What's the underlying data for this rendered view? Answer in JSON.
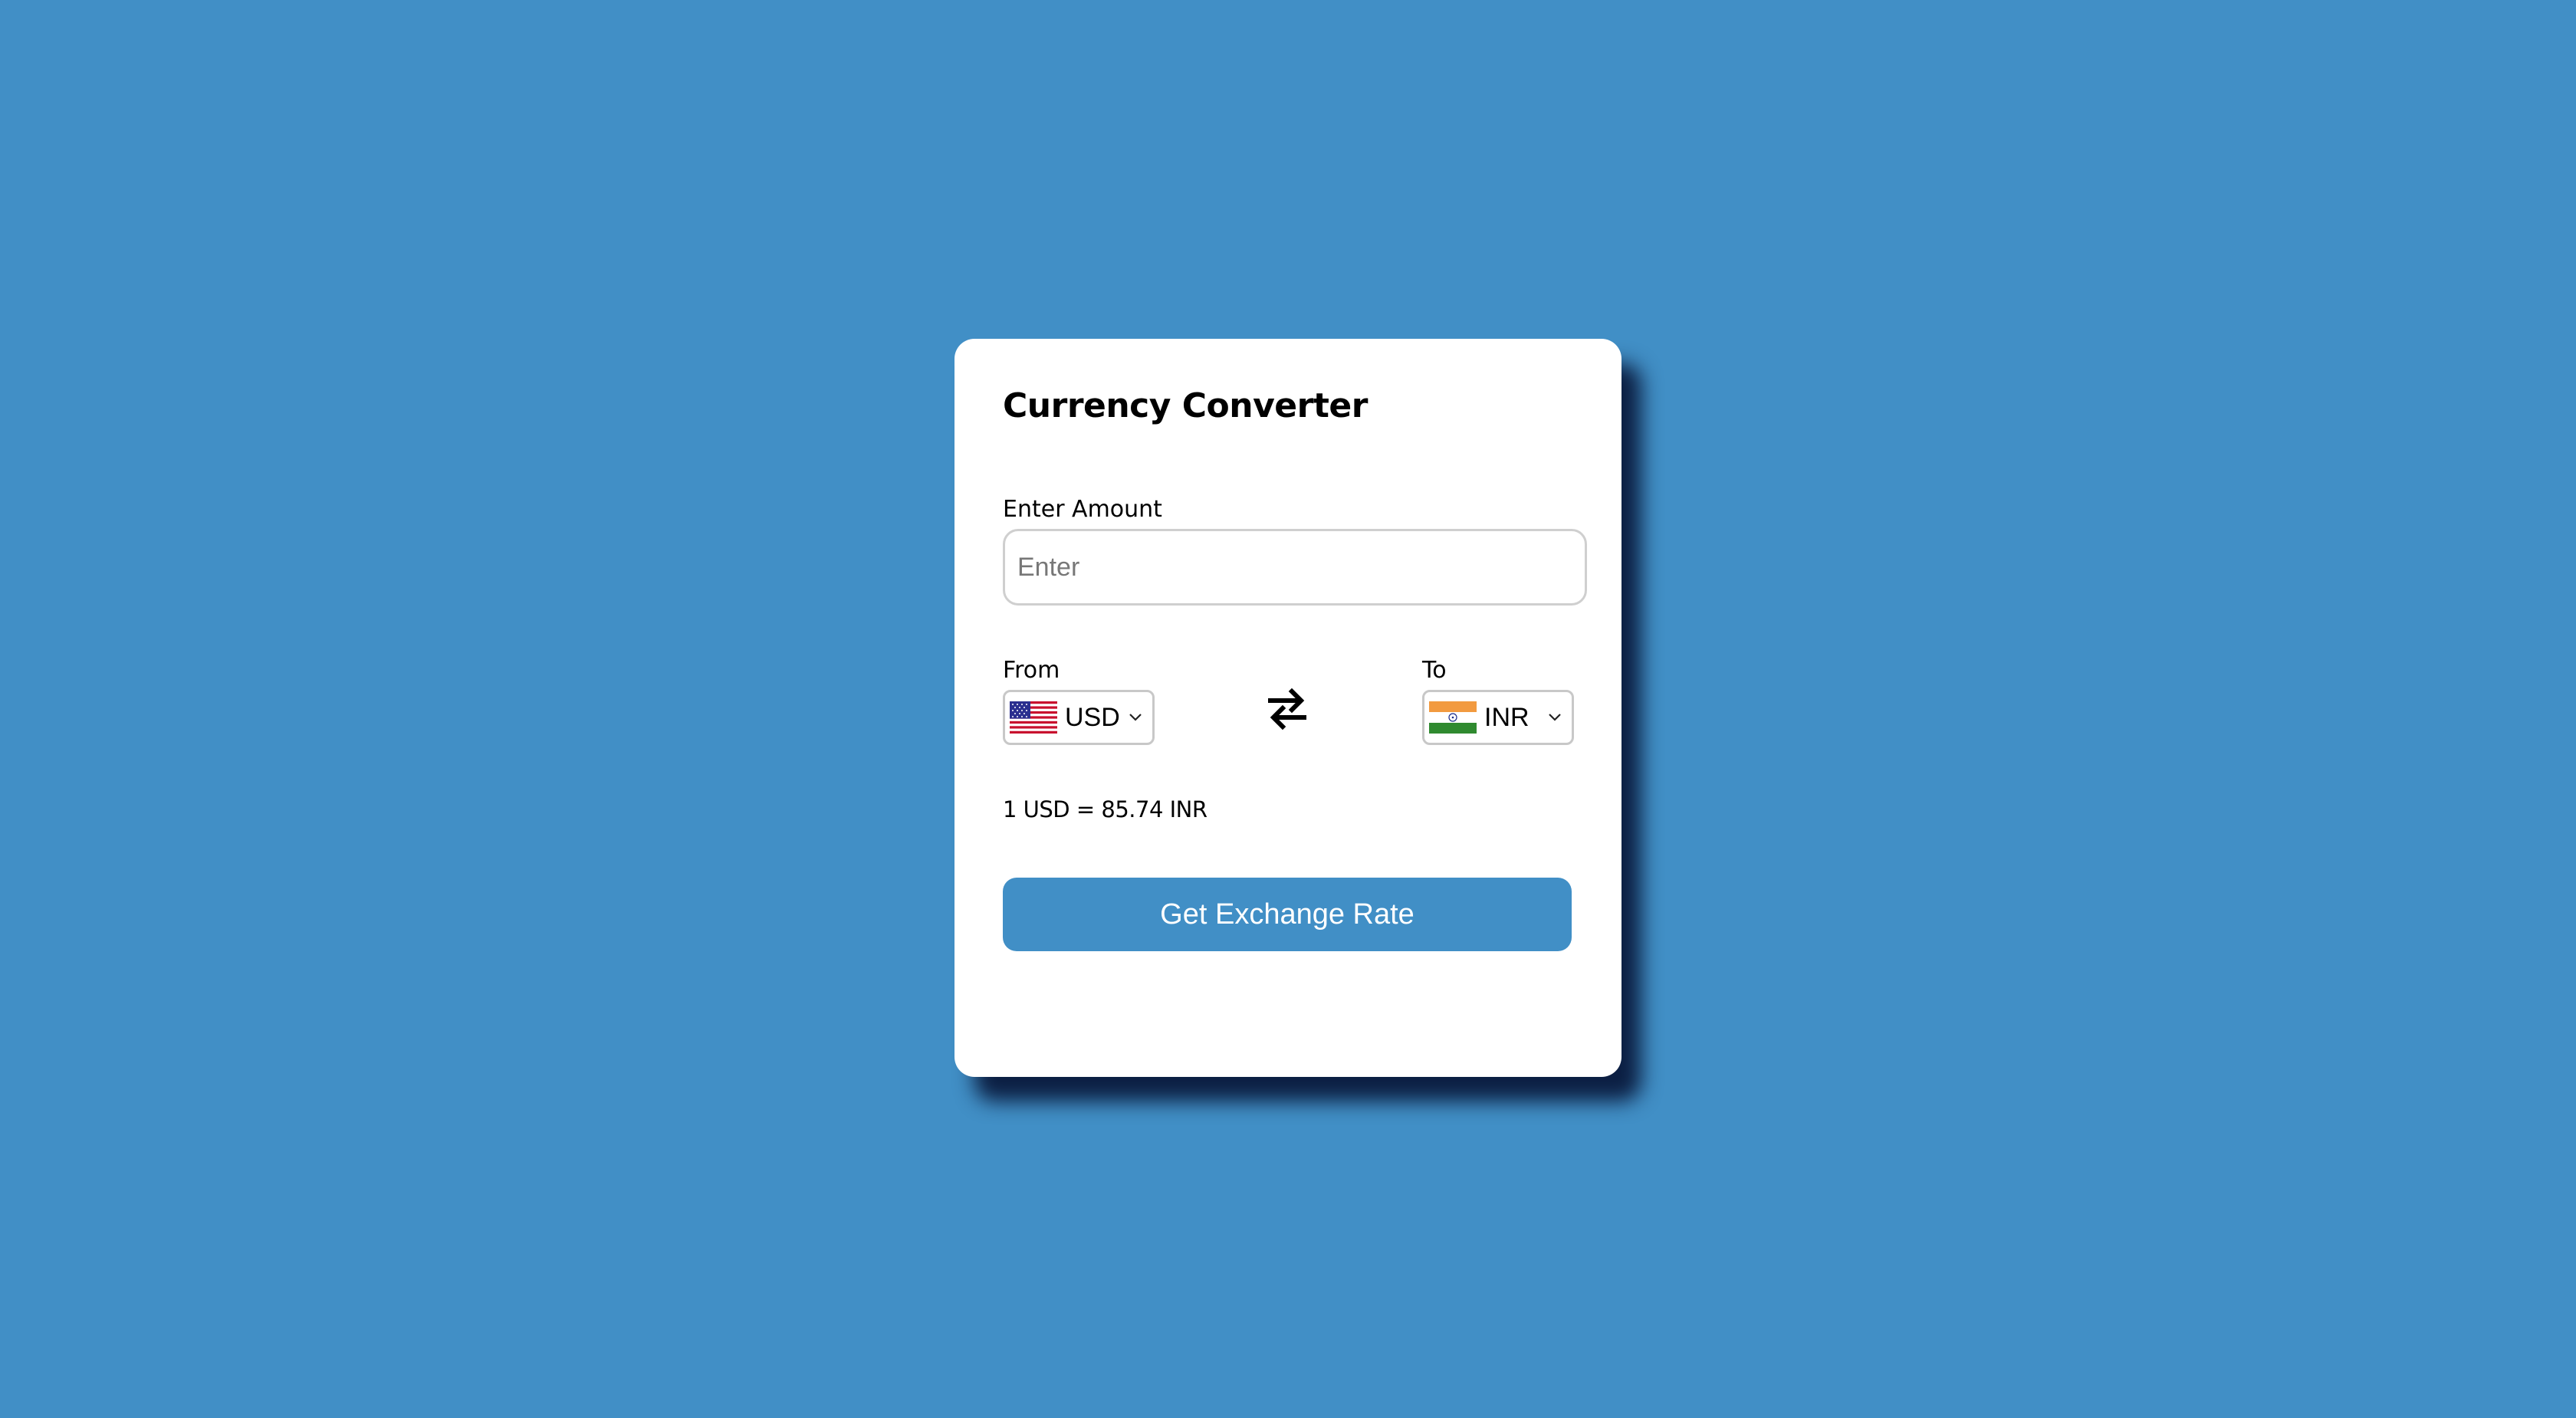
{
  "converter": {
    "title": "Currency Converter",
    "amount_label": "Enter Amount",
    "amount_placeholder": "Enter",
    "amount_value": "",
    "from_label": "From",
    "to_label": "To",
    "from_currency": "USD",
    "from_flag_icon": "us-flag-icon",
    "to_currency": "INR",
    "to_flag_icon": "india-flag-icon",
    "swap_icon": "swap-arrows-icon",
    "rate_text": "1 USD = 85.74 INR",
    "button_label": "Get Exchange Rate"
  },
  "colors": {
    "background": "#418fc6",
    "card": "#ffffff",
    "button": "#418fc6",
    "button_text": "#ffffff"
  }
}
